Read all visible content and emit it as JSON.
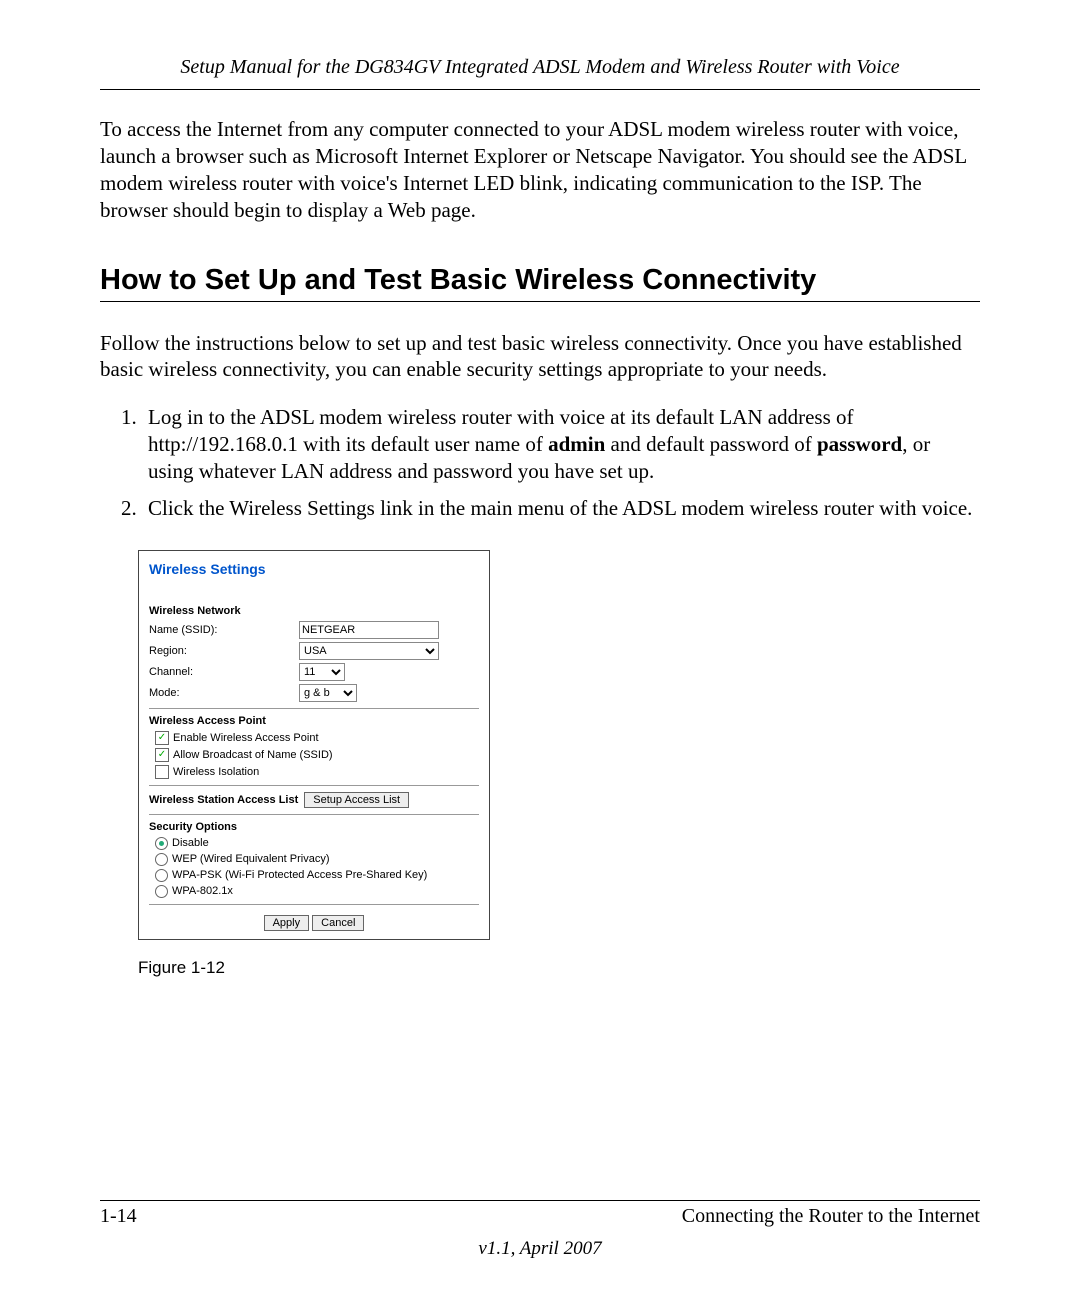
{
  "header": "Setup Manual for the DG834GV Integrated ADSL Modem and Wireless Router with Voice",
  "intro": "To access the Internet from any computer connected to your ADSL modem wireless router with voice, launch a browser such as Microsoft Internet Explorer or Netscape Navigator. You should see the ADSL modem wireless router with voice's Internet LED blink, indicating communication to the ISP. The browser should begin to display a Web page.",
  "section_title": "How to Set Up and Test Basic Wireless Connectivity",
  "follow": "Follow the instructions below to set up and test basic wireless connectivity. Once you have established basic wireless connectivity, you can enable security settings appropriate to your needs.",
  "steps": {
    "s1a": "Log in to the ADSL modem wireless router with voice at its default LAN address of http://192.168.0.1 with its default user name of ",
    "s1b_bold": "admin",
    "s1c": " and default password of ",
    "s1d_bold": "password",
    "s1e": ", or using whatever LAN address and password you have set up.",
    "s2": "Click the Wireless Settings link in the main menu of the ADSL modem wireless router with voice."
  },
  "router": {
    "title": "Wireless Settings",
    "network_head": "Wireless Network",
    "name_lbl": "Name (SSID):",
    "name_val": "NETGEAR",
    "region_lbl": "Region:",
    "region_val": "USA",
    "channel_lbl": "Channel:",
    "channel_val": "11",
    "mode_lbl": "Mode:",
    "mode_val": "g & b",
    "ap_head": "Wireless Access Point",
    "chk_enable": "Enable Wireless Access Point",
    "chk_broadcast": "Allow Broadcast of Name (SSID)",
    "chk_isolation": "Wireless Isolation",
    "access_head": "Wireless Station Access List",
    "access_btn": "Setup Access List",
    "sec_head": "Security Options",
    "opt_disable": "Disable",
    "opt_wep": "WEP (Wired Equivalent Privacy)",
    "opt_wpapsk": "WPA-PSK (Wi-Fi Protected Access Pre-Shared Key)",
    "opt_wpa802": "WPA-802.1x",
    "apply": "Apply",
    "cancel": "Cancel"
  },
  "fig_caption": "Figure 1-12",
  "footer": {
    "page": "1-14",
    "chapter": "Connecting the Router to the Internet",
    "version": "v1.1, April 2007"
  }
}
